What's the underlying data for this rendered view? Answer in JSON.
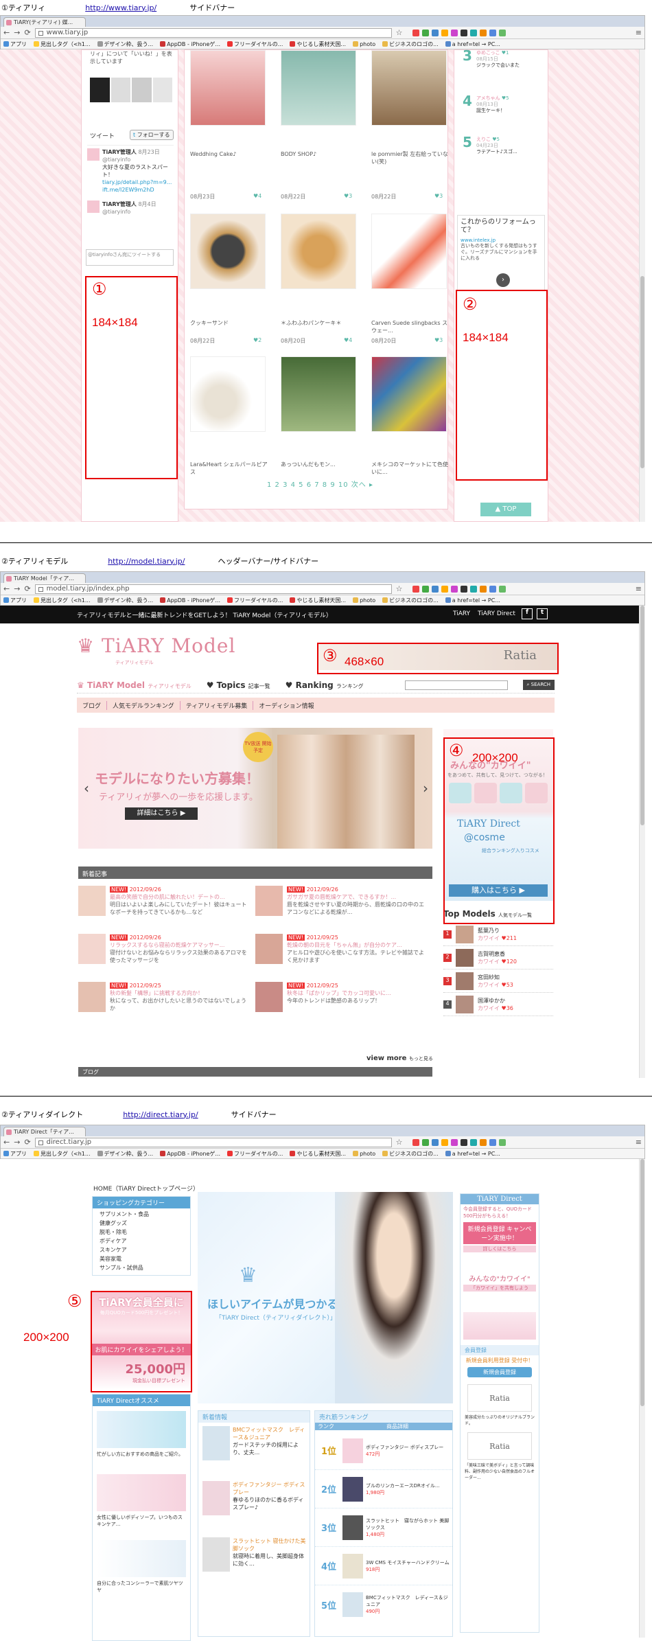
{
  "sections": [
    {
      "label": "①ティアリィ",
      "url": "http://www.tiary.jp/",
      "desc": "サイドバナー",
      "tab": "TiARY(ティアリィ) 媒...",
      "address": "www.tiary.jp",
      "bookmarks": [
        "アプリ",
        "見出しタグ（<h1...",
        "デザイン枠、扱う...",
        "AppDB - iPhoneゲ...",
        "フリーダイヤルの...",
        "やじるし素材天国...",
        "photo",
        "ビジネスのロゴの...",
        "a href=tel → PC..."
      ],
      "sidebar": {
        "intro": "リィ」について「いいね！」を表示しています",
        "tweet_title": "ツイート",
        "follow": "フォローする",
        "tweets": [
          {
            "name": "TiARY管理人",
            "handle": "@tiaryinfo",
            "time": "8月23日",
            "text": "大好きな夏のラストスパート！",
            "link": "tiary.jp/detail.php?m=9...",
            "link2": "ift.me/I2EW9m2hD"
          },
          {
            "name": "TiARY管理人",
            "handle": "@tiaryinfo",
            "time": "8月4日"
          }
        ],
        "tweet_box": "@tiaryinfoさん宛にツイートする"
      },
      "posts": [
        {
          "date": "",
          "likes": "",
          "caption": "Weddhing Cake♪"
        },
        {
          "date": "",
          "likes": "",
          "caption": "BODY SHOP♪"
        },
        {
          "date": "",
          "likes": "",
          "caption": "le pommier製 左右絵っていない(笑)"
        },
        {
          "date": "08月23日",
          "likes": "4",
          "caption": "クッキーサンド"
        },
        {
          "date": "08月22日",
          "likes": "3",
          "caption": "＊ふわふわパンケーキ＊"
        },
        {
          "date": "08月22日",
          "likes": "3",
          "caption": "Carven Suede slingbacks スウェー..."
        },
        {
          "date": "08月22日",
          "likes": "2",
          "caption": "Lara&Heart シェルパールピアス"
        },
        {
          "date": "08月20日",
          "likes": "4",
          "caption": "あっついんだもモン..."
        },
        {
          "date": "08月20日",
          "likes": "3",
          "caption": "メキシコのマーケットにて色使いに..."
        }
      ],
      "pager": "1 2 3 4 5 6 7 8 9 10 次へ ▸",
      "ranking": [
        {
          "n": "3",
          "name": "ゆめこっこ",
          "date": "08月15日",
          "likes": "1",
          "text": "ジラックで会いまた"
        },
        {
          "n": "4",
          "name": "アメちゃん",
          "date": "08月13日",
          "likes": "5",
          "text": "誕生ケーキ！"
        },
        {
          "n": "5",
          "name": "えりこ",
          "date": "04月23日",
          "likes": "5",
          "text": "ラテアート♪スゴ..."
        }
      ],
      "ad": {
        "title": "これからのリフォームって？",
        "domain": "www.intelex.jp",
        "text": "古いものを新しくする発想はもうすぐ。リーズナブルにマンションを手に入れる"
      },
      "top": "▲ TOP",
      "banners": [
        {
          "num": "①",
          "size": "184×184"
        },
        {
          "num": "②",
          "size": "184×184"
        }
      ]
    },
    {
      "label": "②ティアリィモデル",
      "url": "http://model.tiary.jp/",
      "desc": "ヘッダーバナー/サイドバナー",
      "tab": "TiARY Model「ティア...",
      "address": "model.tiary.jp/index.php",
      "topbar": "ティアリィモデルと一緒に最新トレンドをGETしよう！ TiARY Model（ティアリィモデル）",
      "topbar_links": [
        "TiARY",
        "TiARY Direct"
      ],
      "logo": "TiARY Model",
      "logo_sub": "ティアリィモデル",
      "nav": [
        {
          "main": "TiARY Model",
          "sub": "ティアリィモデル"
        },
        {
          "main": "Topics",
          "sub": "記事一覧"
        },
        {
          "main": "Ranking",
          "sub": "ランキング"
        }
      ],
      "search_btn": "SEARCH",
      "subnav": [
        "ブログ",
        "人気モデルランキング",
        "ティアリィモデル募集",
        "オーディション情報"
      ],
      "hero": {
        "title": "モデルになりたい方募集！",
        "sub": "ティアリィが夢への一歩を応援します。",
        "btn": "詳細はこちら ▶",
        "badge": "TV放送 開始予定"
      },
      "side_banner": {
        "title": "みんなの\"カワイイ\"",
        "sub": "をあつめて、共有して、見つけて、つながる！",
        "direct": "TiARY Direct",
        "cosme": "@cosme",
        "rank": "総合ランキング入りコスメ",
        "btn": "購入はこちら ▶"
      },
      "news_title": "新着記事",
      "news": [
        {
          "date": "2012/09/26",
          "title": "最高の笑顔で自分の肌に触れたい！デートの...",
          "text": "明日はいよいよ楽しみにしていたデート！彼はキュートなポーチを持ってきているかも…など"
        },
        {
          "date": "2012/09/26",
          "title": "ガサガサ夏の唇乾燥ケアで、できるすか！...",
          "text": "唇を乾燥させやすい夏の時期から、唇乾燥の口の中のエアコンなどによる乾燥が..."
        },
        {
          "date": "2012/09/26",
          "title": "リラックスするなら寝前の乾燥ケアマッサー...",
          "text": "寝付けないとお悩みならリラックス効果のあるアロマを使ったマッサージを"
        },
        {
          "date": "2012/09/25",
          "title": "乾燥の朝の目元を「ちゃん無」が自分のケア...",
          "text": "アヒル口や遊び心を使いこなす方法。テレビや雑誌でよく見かけます"
        },
        {
          "date": "2012/09/25",
          "title": "秋の新髪「構想」に挑戦する方向か！",
          "text": "秋になって、お出かけしたいと思うのではないでしょうか"
        },
        {
          "date": "2012/09/25",
          "title": "秋冬は「ぱかリップ」でカッコ可愛いに...",
          "text": "今年のトレンドは艶感のあるリップ！"
        }
      ],
      "more": "view more",
      "more_sub": "もっと見る",
      "blog": "ブログ",
      "top_models_title": "Top Models",
      "top_models_sub": "人気モデル一覧",
      "models": [
        {
          "n": "1",
          "name": "藍葉乃り",
          "kw": "カワイイ",
          "score": "211"
        },
        {
          "n": "2",
          "name": "吉賀明恵香",
          "kw": "カワイイ",
          "score": "120"
        },
        {
          "n": "3",
          "name": "宮田紗知",
          "kw": "カワイイ",
          "score": "53"
        },
        {
          "n": "4",
          "name": "国澤ゆかか",
          "kw": "カワイイ",
          "score": "36"
        }
      ],
      "banners": [
        {
          "num": "③",
          "size": "468×60",
          "text": "Ratia"
        },
        {
          "num": "④",
          "size": "200×200"
        }
      ]
    },
    {
      "label": "②ティアリィダイレクト",
      "url": "http://direct.tiary.jp/",
      "desc": "サイドバナー",
      "tab": "TiARY Direct「ティア...",
      "address": "direct.tiary.jp",
      "breadcrumb": "HOME（TiARY Directトップページ）",
      "cat_title": "ショッピングカテゴリー",
      "categories": [
        "サプリメント・食品",
        "健康グッズ",
        "脱毛・除毛",
        "ボディケア",
        "スキンケア",
        "美容家電",
        "サンプル・試供品"
      ],
      "hero": {
        "title": "ほしいアイテムが見つかる！",
        "sub": "「TiARY Direct（ティアリィダイレクト）」"
      },
      "left_banner": {
        "title": "TiARY会員全員に",
        "sub": "毎月QUOカード500円をプレゼント！",
        "mid": "お肌にカワイイをシェアしよう！",
        "amount": "25,000円",
        "foot": "現金払い目標プレゼント"
      },
      "reco_title": "TiARY Directオススメ",
      "reco": [
        {
          "text": "忙がしい方におすすめの商品をご紹介。"
        },
        {
          "text": "女性に優しいボディソープ。いつものスキンケア..."
        },
        {
          "text": "自分に合ったコンシーラーで素肌ツヤツヤ"
        }
      ],
      "new_title": "新着情報",
      "new_items": [
        {
          "title": "BMCフィットマスク　レディース＆ジュニア",
          "text": "ガードステッチの採用により、丈夫..."
        },
        {
          "title": "ボディファンタジー ボディスプレー",
          "text": "春ゆるりほのかに香るボディスプレー♪"
        },
        {
          "title": "スラットヒット 寝仕かけた美脚ソック",
          "text": "就寝時に着用し、美脚超身体に効く..."
        }
      ],
      "rank_title": "売れ筋ランキング",
      "rank_cols": [
        "ランク",
        "商品詳細"
      ],
      "ranks": [
        {
          "n": "1位",
          "name": "ボディファンタジー ボディスプレー",
          "price": "472円"
        },
        {
          "n": "2位",
          "name": "ブルのリンカーエースDRオイル...",
          "price": "1,980円"
        },
        {
          "n": "3位",
          "name": "スラットヒット　寝ながらホット 美脚ソックス",
          "price": "1,480円"
        },
        {
          "n": "4位",
          "name": "3W CMS モイスチャーハンドクリーム",
          "price": "918円"
        },
        {
          "n": "5位",
          "name": "BMCフィットマスク　レディース＆ジュニア",
          "price": "490円"
        }
      ],
      "right": {
        "logo": "TiARY Direct",
        "promo": "今会員登録すると、QUOカード500円分がもらえる！",
        "campaign": "新規会員登録 キャンペーン実施中！",
        "detail": "詳しくはこちら",
        "kawaii": "みんなの\"カワイイ\"",
        "share": "「カワイイ」を共有しよう",
        "member_title": "会員登録",
        "member_text": "新規会員利用登録 受付中！",
        "member_btn": "新規会員登録",
        "ratia_text": "美容成分たっぷりのオリジナルブランド。",
        "ratia2_text": "「美味三昧で美ボディ」と言って調味料、副作用の少ない自然食品のフルオーダー..."
      },
      "banners": [
        {
          "num": "⑤",
          "size": "200×200"
        }
      ]
    }
  ],
  "colors": {
    "red": "#e60000",
    "pink": "#f3a0b4",
    "teal": "#5bb8a8",
    "link": "#1a0dab"
  }
}
